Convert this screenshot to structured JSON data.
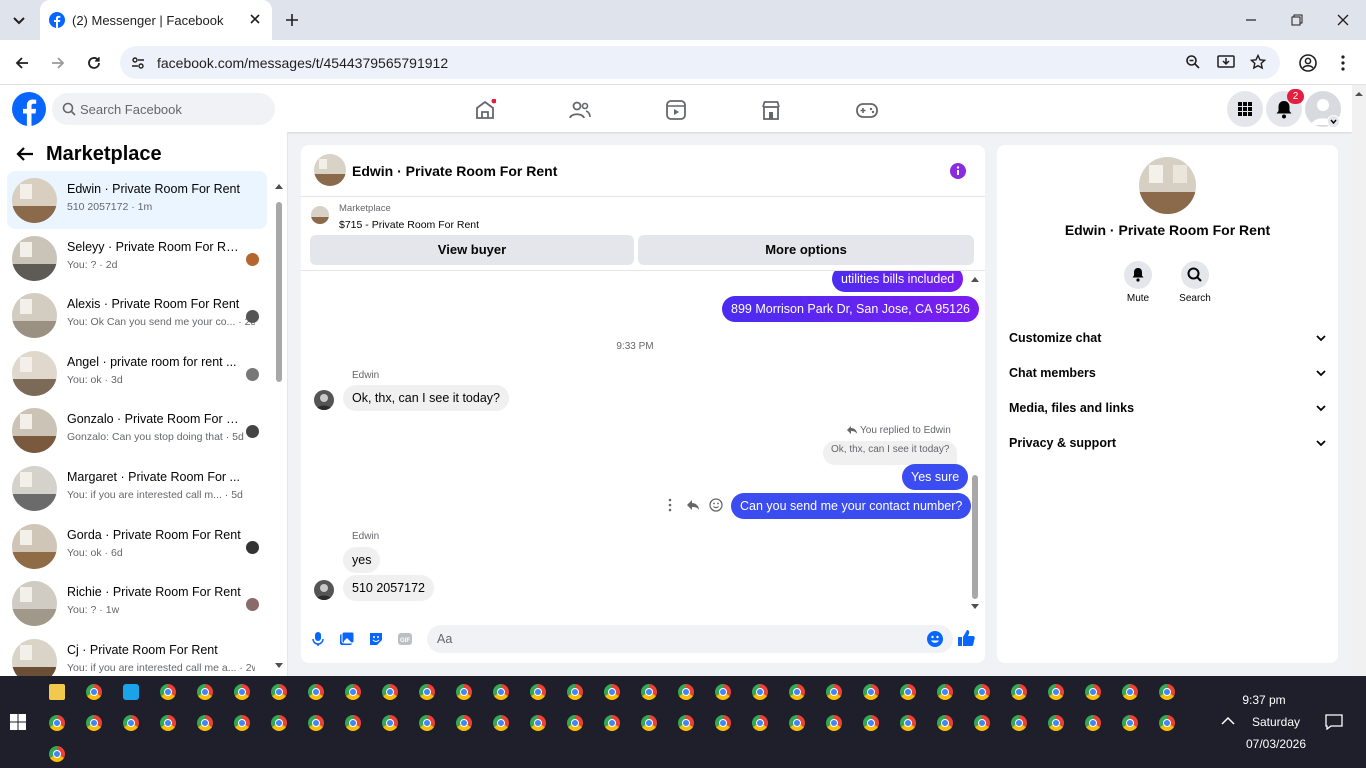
{
  "browser": {
    "tab_title": "(2) Messenger | Facebook",
    "url": "facebook.com/messages/t/4544379565791912"
  },
  "facebook": {
    "search_placeholder": "Search Facebook",
    "notification_count": "2"
  },
  "sidebar": {
    "title": "Marketplace",
    "conversations": [
      {
        "name": "Edwin · Private Room For Rent",
        "preview": "510 2057172 · 1m"
      },
      {
        "name": "Seleyy · Private Room For Rent",
        "preview": "You: ? · 2d"
      },
      {
        "name": "Alexis · Private Room For Rent",
        "preview": "You: Ok Can you send me your co... · 2d"
      },
      {
        "name": "Angel · private room for rent ...",
        "preview": "You: ok · 3d"
      },
      {
        "name": "Gonzalo · Private Room For Rent",
        "preview": "Gonzalo: Can you stop doing that · 5d"
      },
      {
        "name": "Margaret · Private Room For ...",
        "preview": "You: if you are interested call m... · 5d"
      },
      {
        "name": "Gorda · Private Room For Rent",
        "preview": "You: ok · 6d"
      },
      {
        "name": "Richie · Private Room For Rent",
        "preview": "You: ? · 1w"
      },
      {
        "name": "Cj · Private Room For Rent",
        "preview": "You: if you are interested call me a... · 2w"
      }
    ]
  },
  "chat": {
    "title": "Edwin · Private Room For Rent",
    "marketplace_label": "Marketplace",
    "listing": "$715 - Private Room For Rent",
    "view_buyer": "View buyer",
    "more_options": "More options",
    "messages": {
      "m1": "utilities bills included",
      "m2": "899 Morrison Park Dr, San Jose, CA 95126",
      "time": "9:33 PM",
      "sender1": "Edwin",
      "m3": "Ok, thx, can I see it today?",
      "replied_to": "You replied to Edwin",
      "quoted": "Ok, thx, can I see it today?",
      "m4": "Yes sure",
      "m5": "Can you send me your contact number?",
      "sender2": "Edwin",
      "m6": "yes",
      "m7": "510 2057172"
    },
    "composer_placeholder": "Aa"
  },
  "info": {
    "name": "Edwin · Private Room For Rent",
    "mute": "Mute",
    "search": "Search",
    "sections": [
      "Customize chat",
      "Chat members",
      "Media, files and links",
      "Privacy & support"
    ]
  },
  "taskbar": {
    "time": "9:37 pm",
    "day": "Saturday",
    "date": "07/03/2026"
  },
  "colors": {
    "fb_blue": "#0866ff",
    "purple": "#8a2be2",
    "messenger_blue": "#3b4cf0"
  }
}
